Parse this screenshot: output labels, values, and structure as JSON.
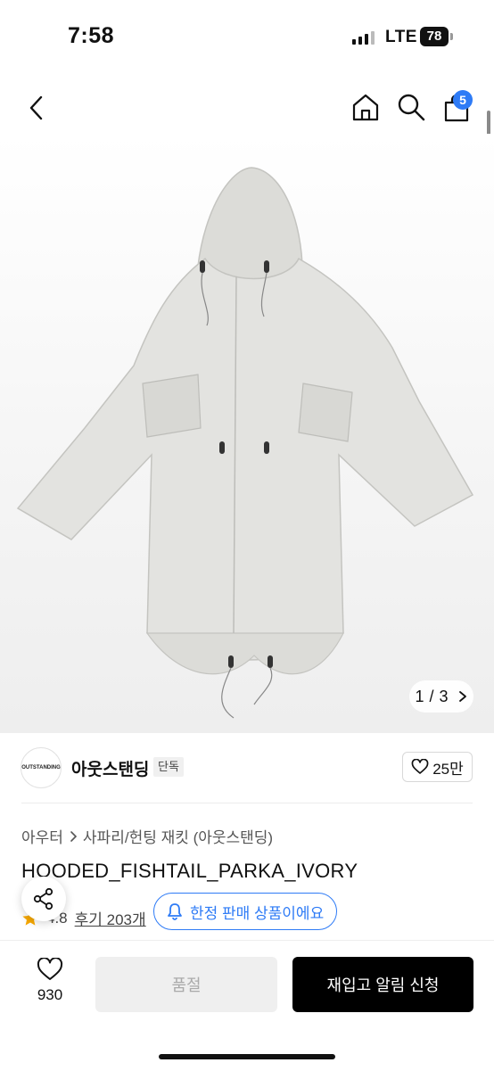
{
  "status_bar": {
    "time": "7:58",
    "network": "LTE",
    "battery": "78"
  },
  "header": {
    "cart_count": "5"
  },
  "gallery": {
    "current": "1",
    "separator": "/",
    "total": "3"
  },
  "brand": {
    "logo_text": "OUTSTANDING",
    "name": "아웃스탠딩",
    "tag": "단독",
    "likes": "25만"
  },
  "product": {
    "breadcrumb": [
      "아우터",
      "사파리/헌팅 재킷 (아웃스탠딩)"
    ],
    "title": "HOODED_FISHTAIL_PARKA_IVORY",
    "rating_partial": "4.8",
    "reviews": "후기 203개",
    "limited_label": "한정 판매 상품이에요"
  },
  "bottom_bar": {
    "wish_count": "930",
    "soldout_label": "품절",
    "restock_label": "재입고 알림 신청"
  },
  "colors": {
    "accent": "#2e7bf6",
    "star": "#f7a800",
    "primary_button": "#000000"
  }
}
